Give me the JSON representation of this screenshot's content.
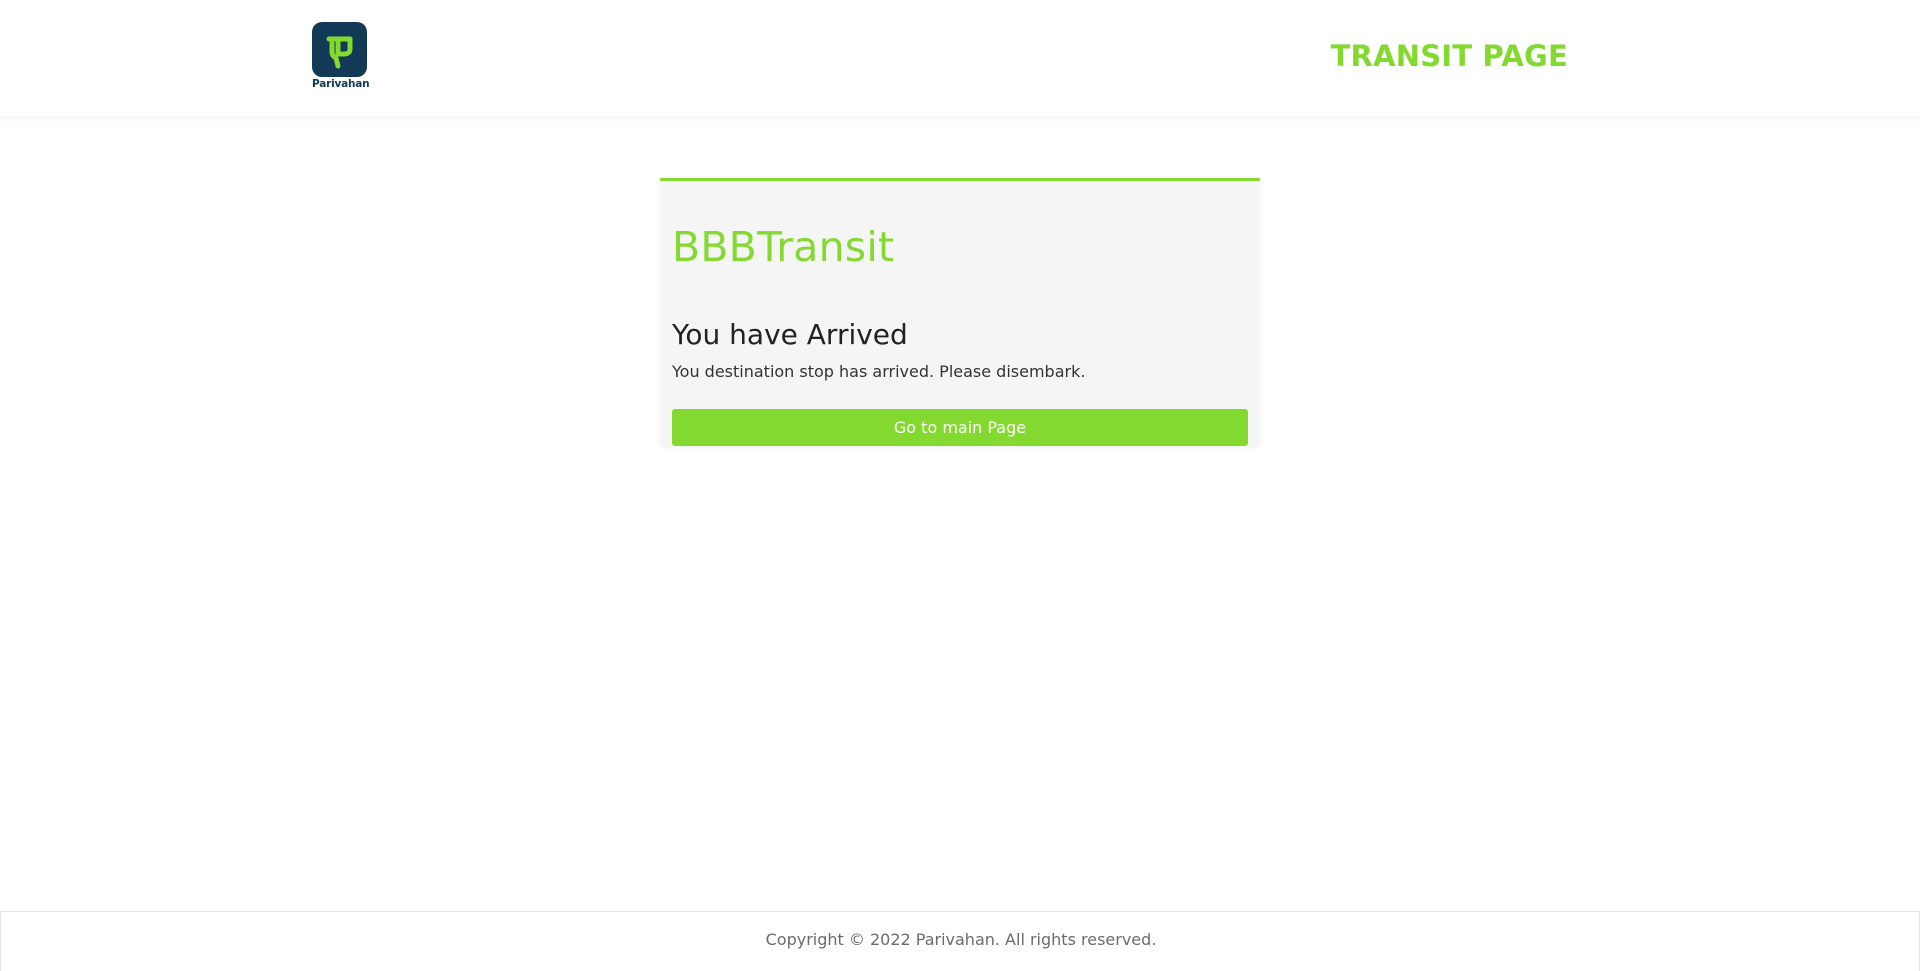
{
  "header": {
    "logo_icon": "parivahan-logo-icon",
    "logo_text": "Parivahan",
    "title": "TRANSIT PAGE"
  },
  "card": {
    "brand": "BBBTransit",
    "heading": "You have Arrived",
    "message": "You destination stop has arrived. Please disembark.",
    "button_label": "Go to main Page"
  },
  "footer": {
    "copyright": "Copyright © 2022 Parivahan. All rights reserved."
  },
  "colors": {
    "accent": "#84d930",
    "logo_bg": "#123a57",
    "card_bg": "#f5f5f5",
    "footer_text": "#6b6b6b"
  }
}
